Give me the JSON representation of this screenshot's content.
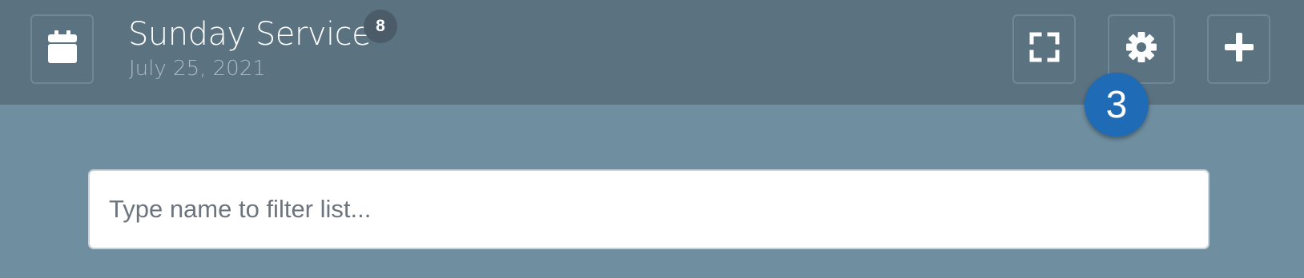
{
  "header": {
    "title": "Sunday Service",
    "date": "July 25, 2021",
    "count_badge": "8",
    "icons": {
      "calendar": "calendar-icon",
      "fullscreen": "fullscreen-icon",
      "settings": "gear-icon",
      "add": "plus-icon"
    }
  },
  "annotation": {
    "step_number": "3"
  },
  "search": {
    "value": "",
    "placeholder": "Type name to filter list..."
  },
  "colors": {
    "header_bg": "#5b7280",
    "page_bg": "#6f8fa1",
    "step_badge": "#1f6bb5",
    "count_badge": "#4b5c68"
  }
}
